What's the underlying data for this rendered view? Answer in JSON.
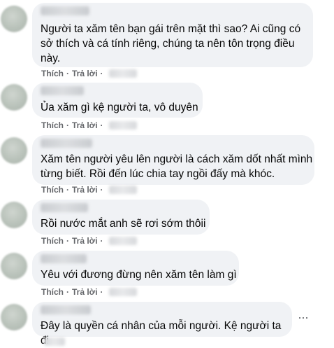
{
  "action_labels": {
    "like": "Thích",
    "reply": "Trả lời",
    "separator": "·"
  },
  "comments": [
    {
      "lines": [
        "Người ta xăm tên bạn gái trên mặt thì sao? Ai cũng có",
        "sở thích và cá tính riêng, chúng ta nên tôn trọng điều",
        "này."
      ]
    },
    {
      "lines": [
        "Ủa xăm gì kệ người ta, vô duyên"
      ]
    },
    {
      "lines": [
        "Xăm tên người yêu lên người là cách xăm dốt nhất mình",
        "từng biết. Rồi đến lúc chia tay ngồi đấy mà khóc."
      ]
    },
    {
      "lines": [
        "Rồi nước mắt anh sẽ rơi sớm thôii"
      ]
    },
    {
      "lines": [
        "Yêu với đương đừng nên xăm tên làm gì"
      ]
    },
    {
      "lines": [
        "Đây là quyền cá nhân của mỗi người. Kệ người ta đi"
      ]
    }
  ],
  "more_options": "···",
  "icons": {
    "avatar": "blurred-profile-photo",
    "more": "more-options-icon"
  }
}
